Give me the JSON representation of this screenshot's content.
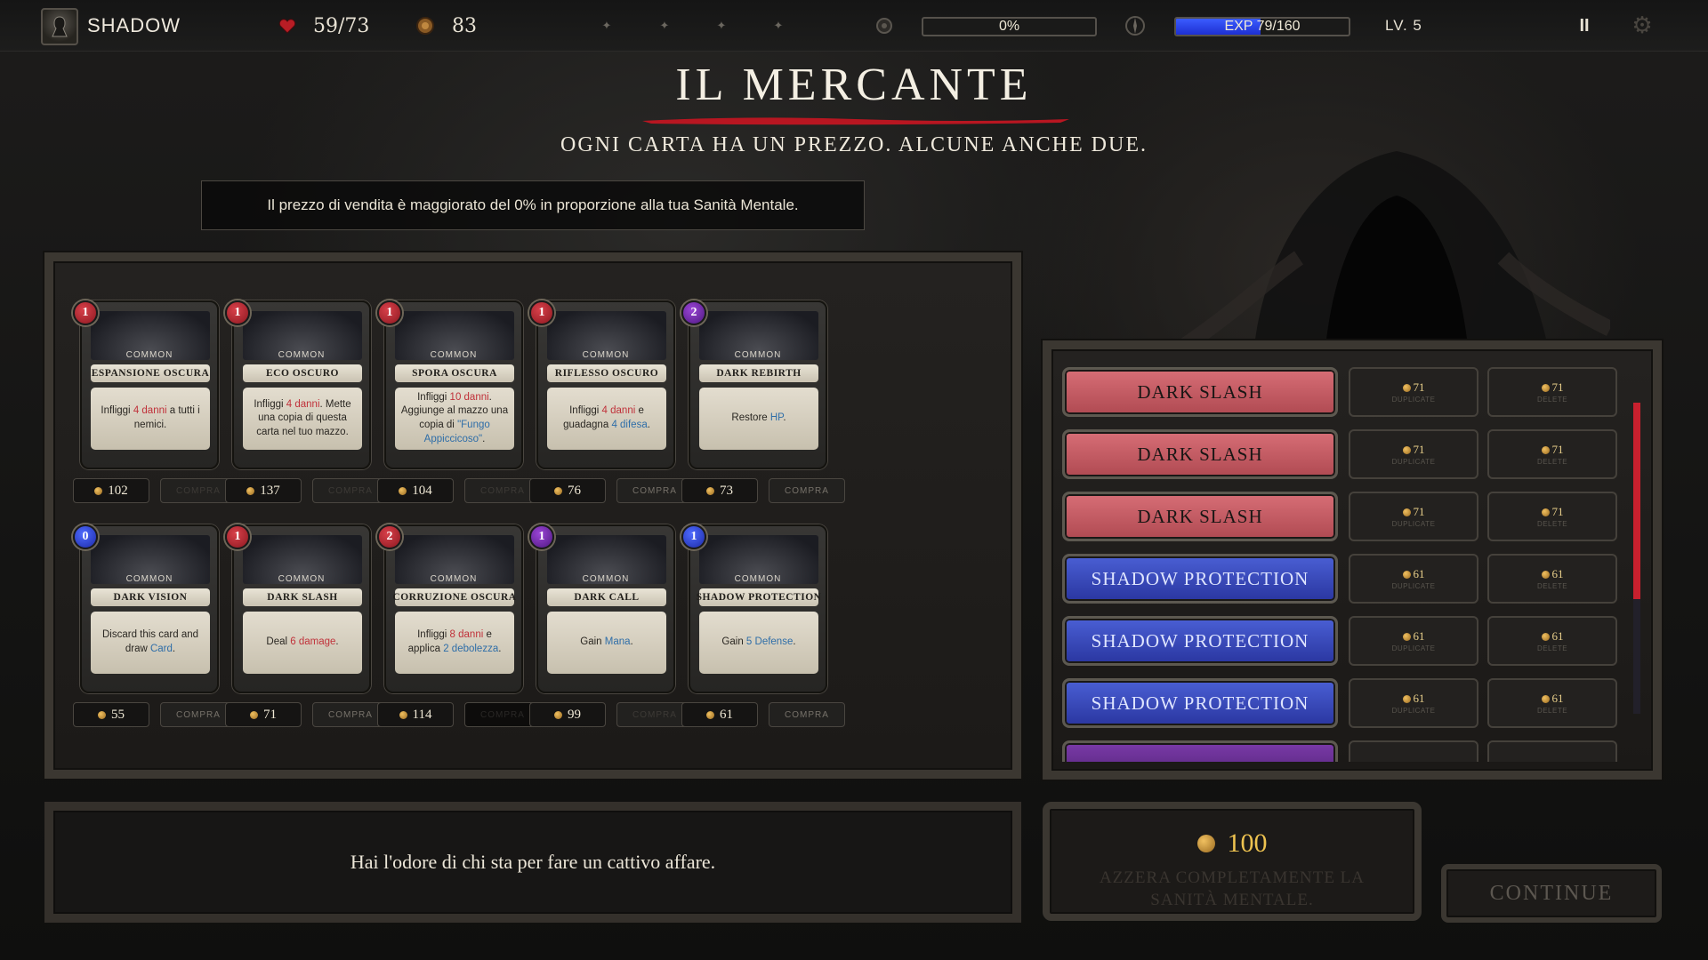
{
  "hud": {
    "hero_name": "SHADOW",
    "hp": "59/73",
    "gold": "83",
    "sanity_text": "0%",
    "sanity_fraction": 0,
    "exp_text": "EXP 79/160",
    "exp_fraction": 0.49,
    "level": "LV. 5",
    "pause_label": "II"
  },
  "header": {
    "title": "IL MERCANTE",
    "subtitle": "OGNI CARTA HA UN PREZZO. ALCUNE ANCHE DUE.",
    "info": "Il prezzo di vendita è maggiorato del 0% in proporzione alla tua Sanità Mentale."
  },
  "shop": {
    "cards": [
      {
        "cost": "1",
        "cost_color": "red",
        "rarity": "COMMON",
        "name": "ESPANSIONE OSCURA",
        "desc": [
          "Infliggi ",
          {
            "k": "4 danni"
          },
          " a tutti i nemici."
        ],
        "price": "102",
        "buy": "COMPRA",
        "buy_state": "dim"
      },
      {
        "cost": "1",
        "cost_color": "red",
        "rarity": "COMMON",
        "name": "ECO OSCURO",
        "desc": [
          "Infliggi ",
          {
            "k": "4 danni"
          },
          ". Mette una copia di questa carta nel tuo mazzo."
        ],
        "price": "137",
        "buy": "COMPRA",
        "buy_state": "dim"
      },
      {
        "cost": "1",
        "cost_color": "red",
        "rarity": "COMMON",
        "name": "SPORA OSCURA",
        "desc": [
          "Infliggi ",
          {
            "k": "10 danni"
          },
          ". Aggiunge al mazzo una copia di ",
          {
            "b": "\"Fungo Appiccicoso\""
          },
          "."
        ],
        "price": "104",
        "buy": "COMPRA",
        "buy_state": "dim"
      },
      {
        "cost": "1",
        "cost_color": "red",
        "rarity": "COMMON",
        "name": "RIFLESSO OSCURO",
        "desc": [
          "Infliggi ",
          {
            "k": "4 danni"
          },
          " e guadagna ",
          {
            "b": "4 difesa"
          },
          "."
        ],
        "price": "76",
        "buy": "COMPRA",
        "buy_state": "normal"
      },
      {
        "cost": "2",
        "cost_color": "purple",
        "rarity": "COMMON",
        "name": "DARK REBIRTH",
        "desc": [
          "Restore ",
          {
            "b": "HP"
          },
          "."
        ],
        "price": "73",
        "buy": "COMPRA",
        "buy_state": "normal"
      },
      {
        "cost": "0",
        "cost_color": "blue",
        "rarity": "COMMON",
        "name": "DARK VISION",
        "desc": [
          "Discard this card and draw ",
          {
            "b": "Card"
          },
          "."
        ],
        "price": "55",
        "buy": "COMPRA",
        "buy_state": "normal"
      },
      {
        "cost": "1",
        "cost_color": "red",
        "rarity": "COMMON",
        "name": "DARK SLASH",
        "desc": [
          "Deal ",
          {
            "k": "6 damage"
          },
          "."
        ],
        "price": "71",
        "buy": "COMPRA",
        "buy_state": "normal"
      },
      {
        "cost": "2",
        "cost_color": "red",
        "rarity": "COMMON",
        "name": "CORRUZIONE OSCURA",
        "desc": [
          "Infliggi ",
          {
            "k": "8 danni"
          },
          " e applica ",
          {
            "b": "2 debolezza"
          },
          "."
        ],
        "price": "114",
        "buy": "COMPRA",
        "buy_state": "black"
      },
      {
        "cost": "1",
        "cost_color": "purple",
        "rarity": "COMMON",
        "name": "DARK CALL",
        "desc": [
          "Gain ",
          {
            "b": "Mana"
          },
          "."
        ],
        "price": "99",
        "buy": "COMPRA",
        "buy_state": "dim"
      },
      {
        "cost": "1",
        "cost_color": "blue",
        "rarity": "COMMON",
        "name": "SHADOW PROTECTION",
        "desc": [
          "Gain ",
          {
            "b": "5 Defense"
          },
          "."
        ],
        "price": "61",
        "buy": "COMPRA",
        "buy_state": "normal"
      }
    ]
  },
  "deck": {
    "duplicate_label": "DUPLICATE",
    "delete_label": "DELETE",
    "scroll_fraction": 0.63,
    "rows": [
      {
        "name": "DARK SLASH",
        "color": "red",
        "dup_price": "71",
        "del_price": "71"
      },
      {
        "name": "DARK SLASH",
        "color": "red",
        "dup_price": "71",
        "del_price": "71"
      },
      {
        "name": "DARK SLASH",
        "color": "red",
        "dup_price": "71",
        "del_price": "71"
      },
      {
        "name": "SHADOW PROTECTION",
        "color": "blue",
        "dup_price": "61",
        "del_price": "61"
      },
      {
        "name": "SHADOW PROTECTION",
        "color": "blue",
        "dup_price": "61",
        "del_price": "61"
      },
      {
        "name": "SHADOW PROTECTION",
        "color": "blue",
        "dup_price": "61",
        "del_price": "61"
      },
      {
        "name": "",
        "color": "purple",
        "dup_price": "",
        "del_price": ""
      }
    ]
  },
  "dialogue": "Hai l'odore di chi sta per fare un cattivo affare.",
  "reset": {
    "price": "100",
    "label": "AZZERA COMPLETAMENTE LA SANITÀ MENTALE."
  },
  "continue_label": "CONTINUE",
  "colors": {
    "accent_red": "#c8202e",
    "exp_blue": "#2a40e0",
    "gold": "#eec350"
  },
  "icons": [
    "portrait-icon",
    "heart-icon",
    "coin-icon",
    "rune-icon",
    "sanity-icon",
    "compass-icon",
    "gear-icon",
    "pause-icon"
  ]
}
